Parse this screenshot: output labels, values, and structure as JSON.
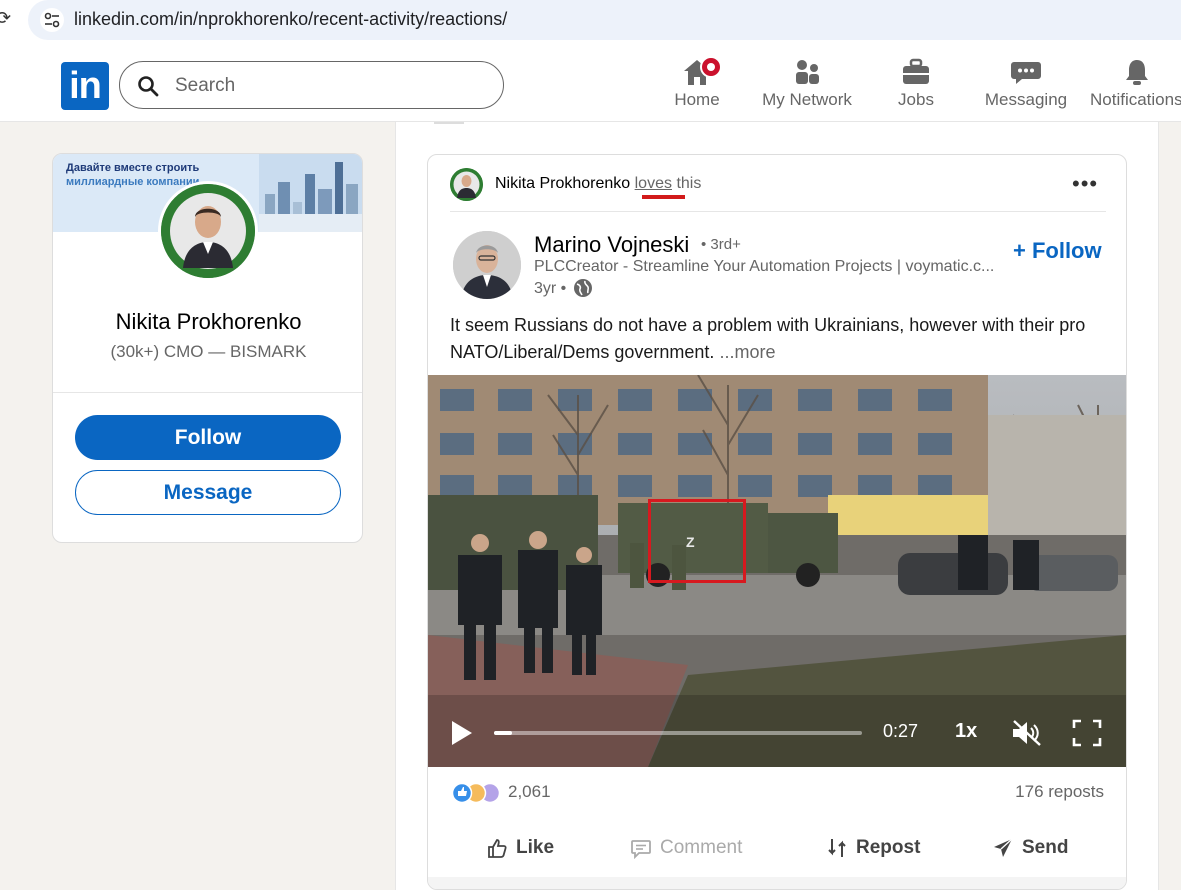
{
  "browser": {
    "url": "linkedin.com/in/nprokhorenko/recent-activity/reactions/"
  },
  "header": {
    "logo": "in",
    "search_placeholder": "Search",
    "nav": [
      {
        "label": "Home",
        "icon": "home-icon"
      },
      {
        "label": "My Network",
        "icon": "network-icon"
      },
      {
        "label": "Jobs",
        "icon": "briefcase-icon"
      },
      {
        "label": "Messaging",
        "icon": "chat-icon"
      },
      {
        "label": "Notifications",
        "icon": "bell-icon"
      }
    ]
  },
  "profile_card": {
    "banner_line1": "Давайте вместе строить",
    "banner_line2": "миллиардные компании",
    "name": "Nikita Prokhorenko",
    "title": "(30k+) CMO — BISMARK",
    "follow_label": "Follow",
    "message_label": "Message"
  },
  "post": {
    "reactor": "Nikita Prokhorenko",
    "reaction_verb": "loves",
    "reaction_suffix": "this",
    "author": {
      "name": "Marino Vojneski",
      "degree": "• 3rd+",
      "headline": "PLCCreator - Streamline Your Automation Projects | voymatic.c...",
      "time": "3yr •"
    },
    "follow_label": "+ Follow",
    "text": "It seem Russians do not have a problem with Ukrainians, however with their pro NATO/Liberal/Dems government.",
    "more_label": "...more",
    "video": {
      "time": "0:27",
      "speed": "1x",
      "progress": 0.05,
      "truck_letter": "Z"
    },
    "reactions_count": "2,061",
    "reposts": "176 reposts",
    "actions": [
      {
        "label": "Like"
      },
      {
        "label": "Comment"
      },
      {
        "label": "Repost"
      },
      {
        "label": "Send"
      }
    ]
  },
  "colors": {
    "brand": "#0a66c2",
    "highlight": "#d7191f",
    "badge": "#cb112d"
  }
}
